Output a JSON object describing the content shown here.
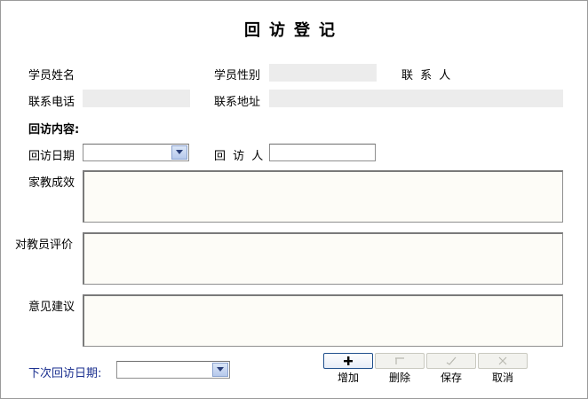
{
  "form": {
    "title": "回访登记",
    "student_name_label": "学员姓名",
    "student_gender_label": "学员性别",
    "contact_person_label": "联 系 人",
    "phone_label": "联系电话",
    "address_label": "联系地址",
    "visit_content_heading": "回访内容:",
    "visit_date_label": "回访日期",
    "visitor_label": "回 访 人",
    "tutoring_result_label": "家教成效",
    "tutor_review_label": "对教员评价",
    "suggestion_label": "意见建议",
    "next_visit_label": "下次回访日期:"
  },
  "values": {
    "student_gender": "",
    "phone": "",
    "address": "",
    "visit_date": "",
    "visitor": "",
    "tutoring_result": "",
    "tutor_review": "",
    "suggestion": "",
    "next_visit_date": ""
  },
  "toolbar": {
    "add_label": "增加",
    "delete_label": "删除",
    "save_label": "保存",
    "cancel_label": "取消"
  },
  "colors": {
    "accent_blue": "#1a2f8f",
    "readonly_bg": "#ececec",
    "textarea_bg": "#fdfcf7"
  }
}
